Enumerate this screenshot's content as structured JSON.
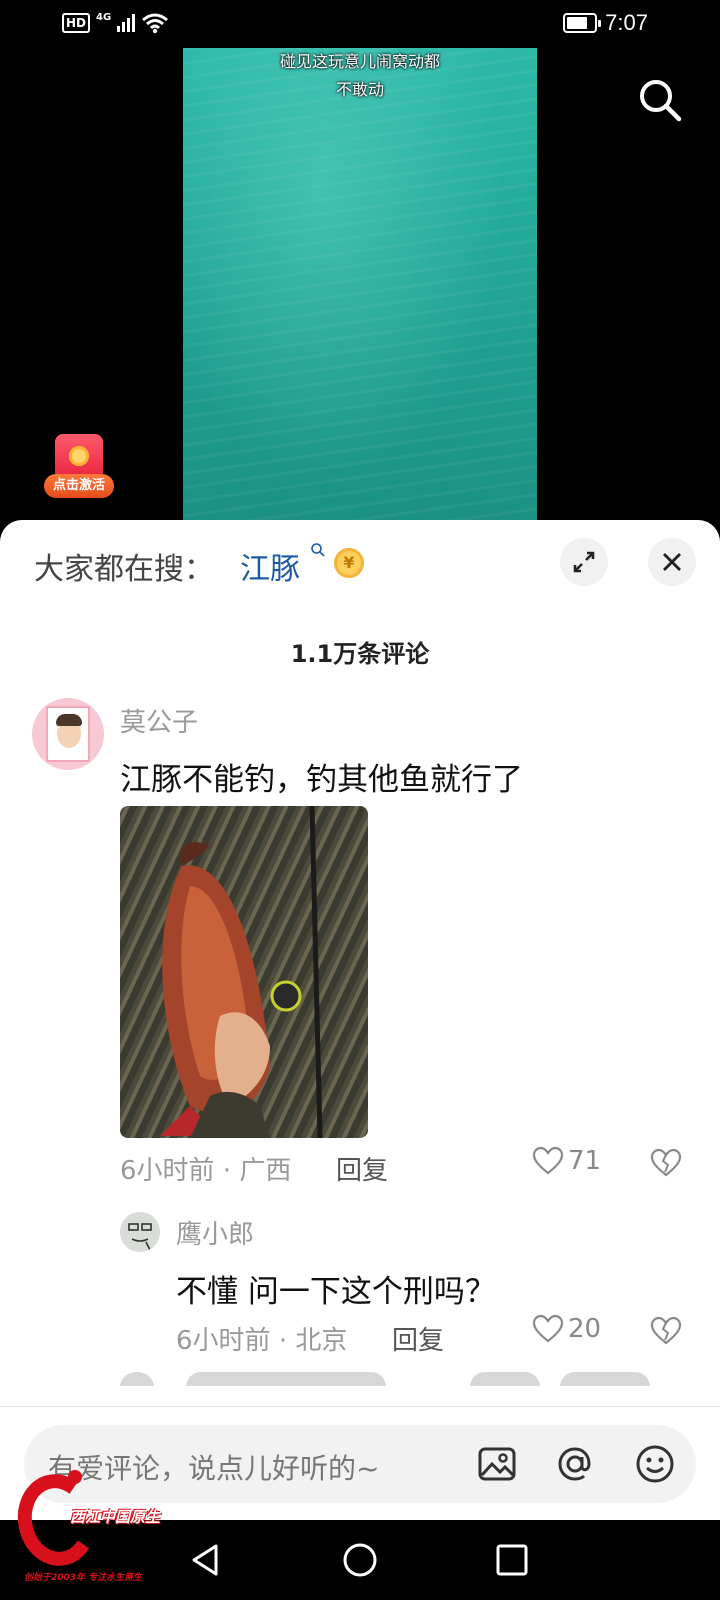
{
  "status_bar": {
    "hd": "HD",
    "network": "4G",
    "time": "7:07"
  },
  "video": {
    "caption_lines": [
      "碰见这玩意儿闹窝动都",
      "不敢动"
    ],
    "activate_label": "点击激活"
  },
  "sheet": {
    "hot_search_prefix": "大家都在搜：",
    "hot_search_term": "江豚",
    "coin_symbol": "¥",
    "comment_count": "1.1万条评论"
  },
  "comments": [
    {
      "username": "莫公子",
      "text": "江豚不能钓，钓其他鱼就行了",
      "meta": "6小时前 · 广西",
      "reply_label": "回复",
      "likes": "71"
    },
    {
      "username": "鹰小郎",
      "text": "不懂 问一下这个刑吗？",
      "meta": "6小时前 · 北京",
      "reply_label": "回复",
      "likes": "20"
    }
  ],
  "input_bar": {
    "placeholder": "有爱评论，说点儿好听的~"
  },
  "watermark": {
    "title": "西江中国原生",
    "tagline": "创始于2003年 专注水生原生"
  },
  "colors": {
    "hot_term": "#1a5aa6",
    "watermark_red": "#d8101b",
    "water": "#23a89a"
  }
}
